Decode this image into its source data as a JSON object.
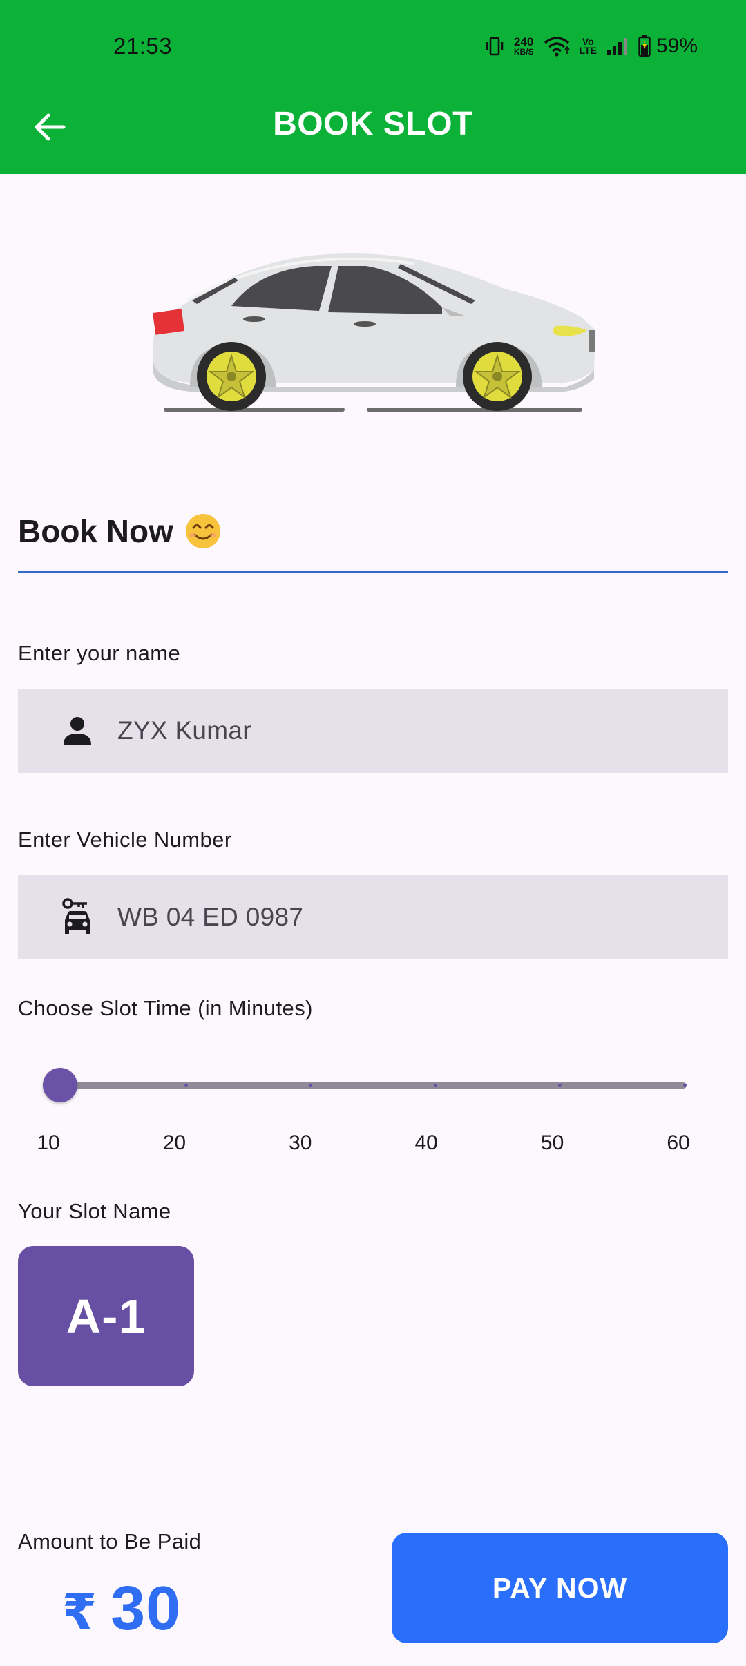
{
  "status_bar": {
    "time": "21:53",
    "net_speed_value": "240",
    "net_speed_unit": "KB/S",
    "volte_top": "Vo",
    "volte_bottom": "LTE",
    "battery": "59%",
    "icons": [
      "vibrate-icon",
      "wifi-icon",
      "signal-icon",
      "battery-icon"
    ]
  },
  "app_bar": {
    "title": "BOOK SLOT",
    "back_icon": "arrow-left-icon",
    "background": "#0bb237"
  },
  "form": {
    "heading": "Book Now",
    "heading_emoji": "smiling-face-icon",
    "name_label": "Enter your name",
    "name_value": "ZYX Kumar",
    "name_icon": "person-icon",
    "vehicle_label": "Enter Vehicle Number",
    "vehicle_value": "WB 04 ED 0987",
    "vehicle_icon": "car-key-icon",
    "slot_time_label": "Choose Slot Time (in Minutes)",
    "slider": {
      "min": 10,
      "max": 60,
      "value": 10,
      "labels": [
        "10",
        "20",
        "30",
        "40",
        "50",
        "60"
      ]
    },
    "slot_name_label": "Your Slot Name",
    "slot_name": "A-1"
  },
  "footer": {
    "amount_label": "Amount to Be Paid",
    "currency": "₹",
    "amount": "30",
    "pay_button": "PAY NOW"
  },
  "colors": {
    "accent_green": "#0bb237",
    "primary_purple": "#674fa3",
    "pay_blue": "#2a6ffb",
    "amount_blue": "#2f6df2"
  }
}
